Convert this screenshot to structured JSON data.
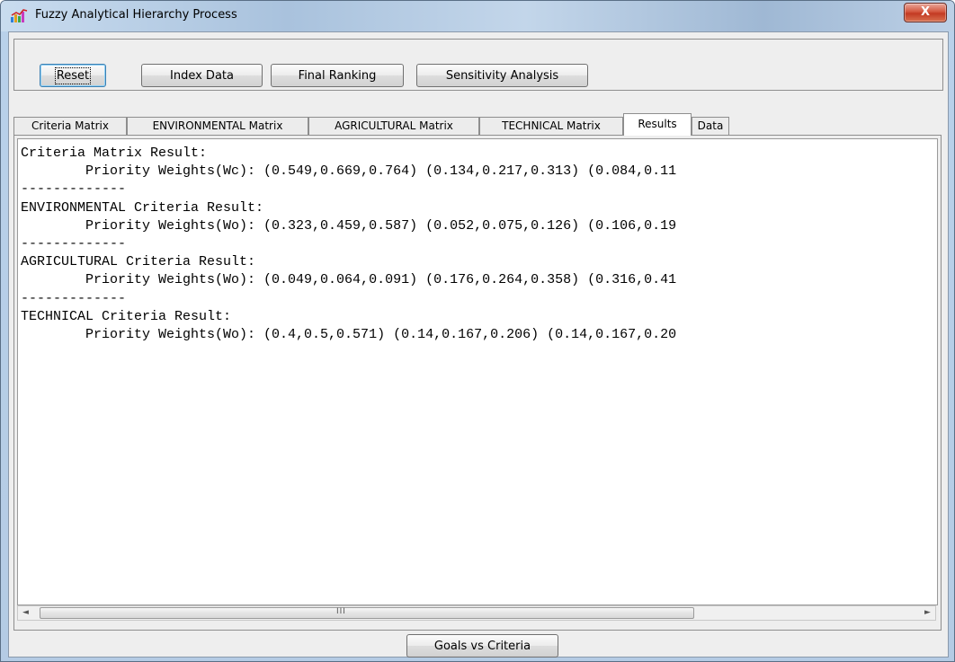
{
  "window": {
    "title": "Fuzzy Analytical Hierarchy Process",
    "close_label": "X"
  },
  "toolbar": {
    "reset_label": "Reset",
    "index_data_label": "Index Data",
    "final_ranking_label": "Final Ranking",
    "sensitivity_label": "Sensitivity Analysis"
  },
  "tabs": [
    {
      "label": "Criteria Matrix"
    },
    {
      "label": "ENVIRONMENTAL Matrix"
    },
    {
      "label": "AGRICULTURAL Matrix"
    },
    {
      "label": "TECHNICAL Matrix"
    },
    {
      "label": "Results",
      "active": true
    },
    {
      "label": "Data"
    }
  ],
  "results": {
    "text": "Criteria Matrix Result:\n        Priority Weights(Wc): (0.549,0.669,0.764) (0.134,0.217,0.313) (0.084,0.11\n-------------\nENVIRONMENTAL Criteria Result:\n        Priority Weights(Wo): (0.323,0.459,0.587) (0.052,0.075,0.126) (0.106,0.19\n-------------\nAGRICULTURAL Criteria Result:\n        Priority Weights(Wo): (0.049,0.064,0.091) (0.176,0.264,0.358) (0.316,0.41\n-------------\nTECHNICAL Criteria Result:\n        Priority Weights(Wo): (0.4,0.5,0.571) (0.14,0.167,0.206) (0.14,0.167,0.20"
  },
  "scrollbar": {
    "left_arrow": "◄",
    "right_arrow": "►",
    "grip": "III"
  },
  "footer": {
    "goals_vs_criteria_label": "Goals vs Criteria"
  }
}
